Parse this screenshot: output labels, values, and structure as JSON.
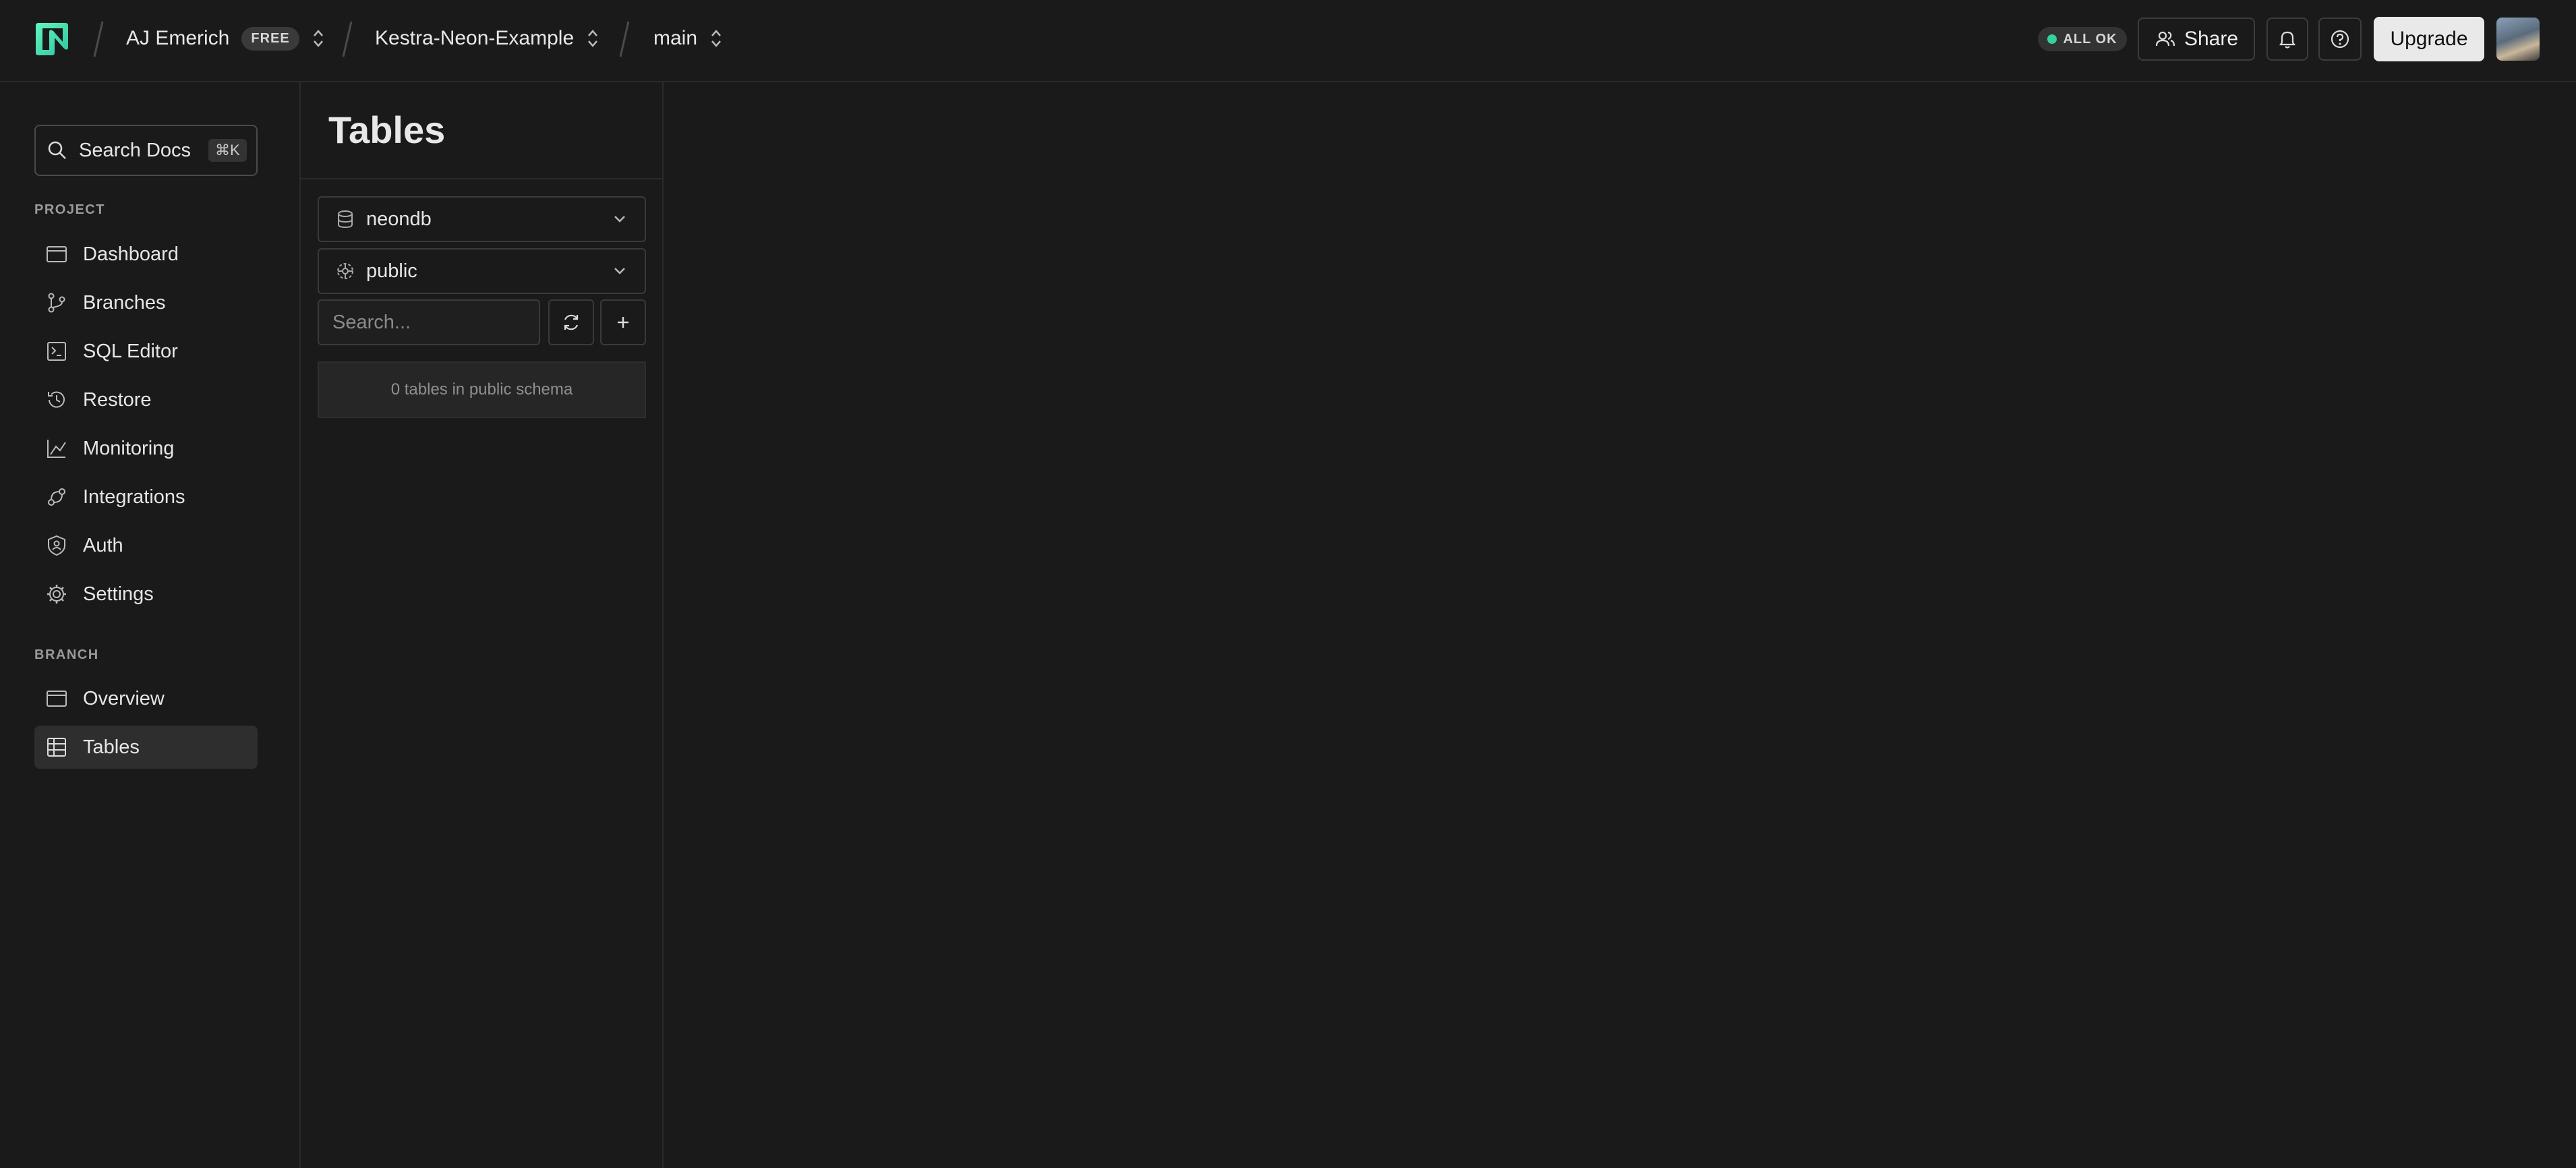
{
  "topbar": {
    "org_name": "AJ Emerich",
    "org_plan": "FREE",
    "project_name": "Kestra-Neon-Example",
    "branch_name": "main",
    "status": "ALL OK",
    "share_label": "Share",
    "upgrade_label": "Upgrade"
  },
  "sidebar": {
    "search_label": "Search Docs",
    "search_shortcut": "⌘K",
    "project_section": "PROJECT",
    "project_items": [
      {
        "label": "Dashboard",
        "icon": "dashboard-icon"
      },
      {
        "label": "Branches",
        "icon": "branches-icon"
      },
      {
        "label": "SQL Editor",
        "icon": "sql-editor-icon"
      },
      {
        "label": "Restore",
        "icon": "restore-icon"
      },
      {
        "label": "Monitoring",
        "icon": "monitoring-icon"
      },
      {
        "label": "Integrations",
        "icon": "integrations-icon"
      },
      {
        "label": "Auth",
        "icon": "auth-icon"
      },
      {
        "label": "Settings",
        "icon": "settings-icon"
      }
    ],
    "branch_section": "BRANCH",
    "branch_items": [
      {
        "label": "Overview",
        "icon": "overview-icon"
      },
      {
        "label": "Tables",
        "icon": "tables-icon",
        "active": true
      }
    ]
  },
  "tables_panel": {
    "title": "Tables",
    "database": "neondb",
    "schema": "public",
    "search_placeholder": "Search...",
    "empty_message": "0 tables in public schema"
  },
  "colors": {
    "background": "#1a1a1a",
    "brand": "#34d399",
    "status_ok": "#34d399",
    "upgrade_bg": "#e9e9e9"
  }
}
